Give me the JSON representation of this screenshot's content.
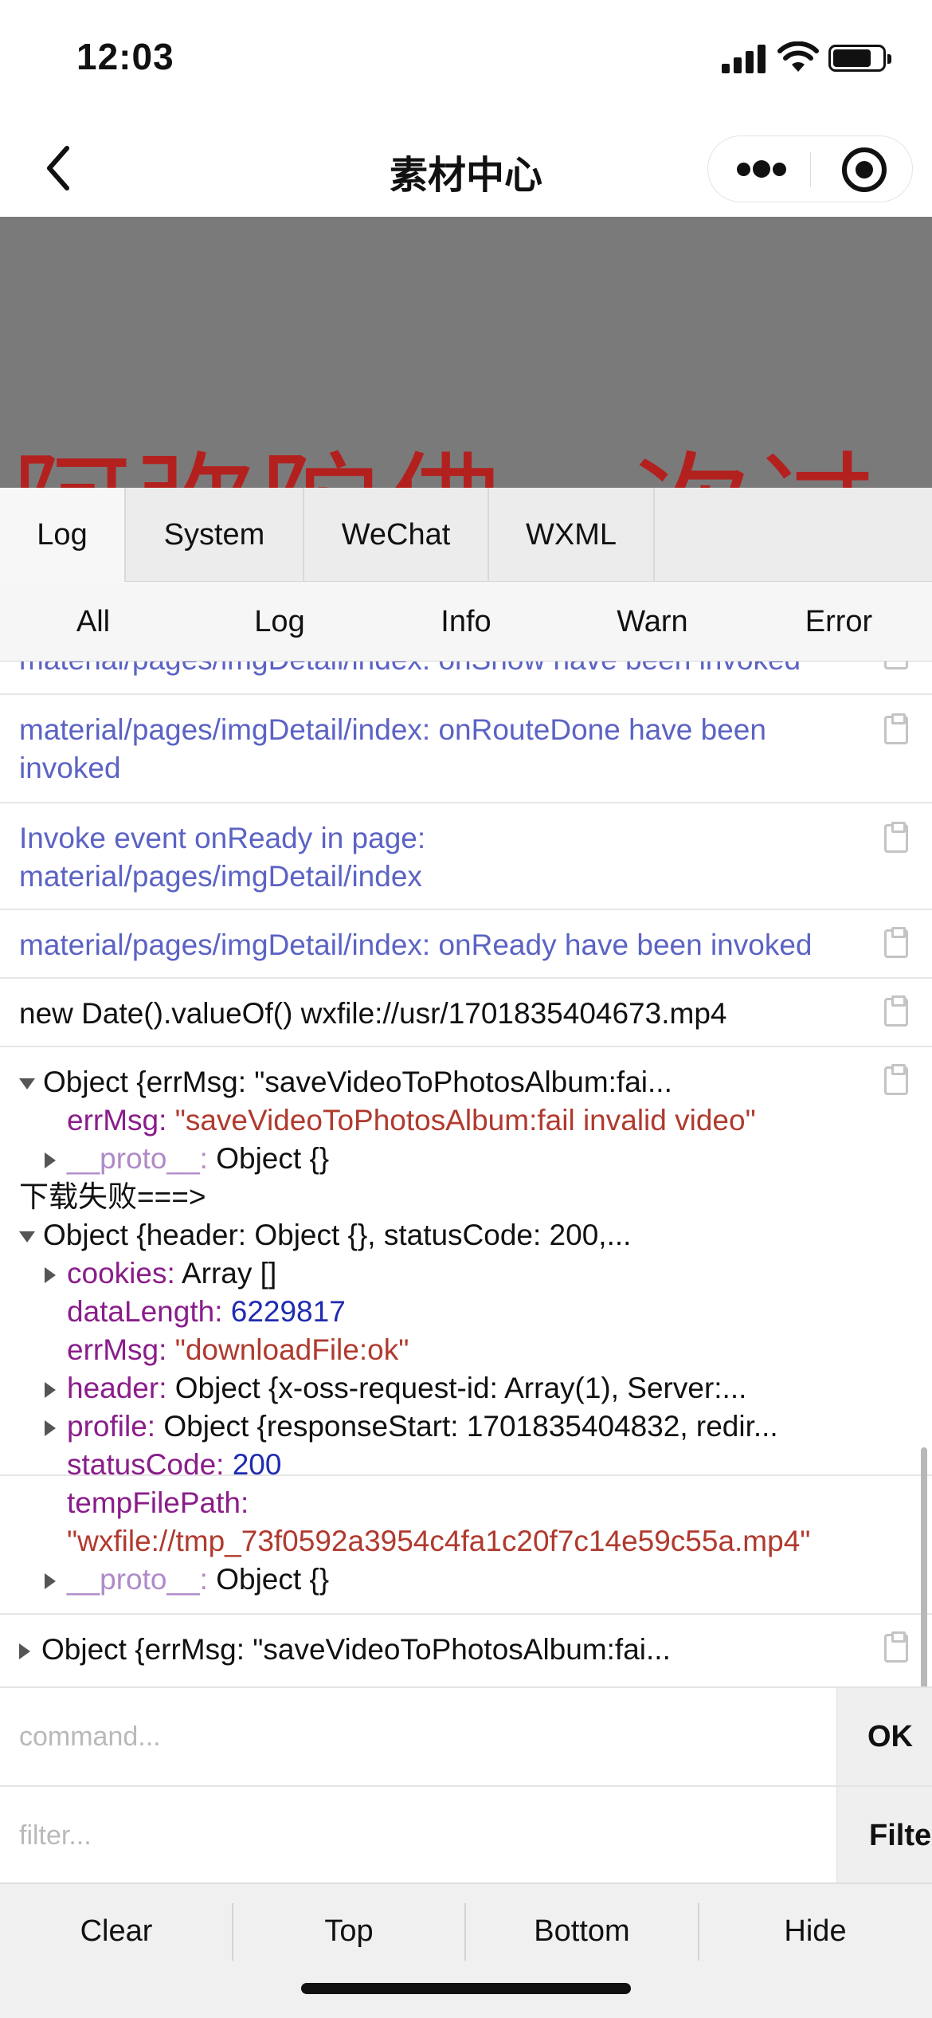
{
  "status_bar": {
    "time": "12:03"
  },
  "nav": {
    "title": "素材中心"
  },
  "page": {
    "banner_text": "阿弥陀佛一次过"
  },
  "vconsole": {
    "tabs": [
      {
        "label": "Log"
      },
      {
        "label": "System"
      },
      {
        "label": "WeChat"
      },
      {
        "label": "WXML"
      }
    ],
    "subtabs": [
      {
        "label": "All"
      },
      {
        "label": "Log"
      },
      {
        "label": "Info"
      },
      {
        "label": "Warn"
      },
      {
        "label": "Error"
      }
    ],
    "logs": {
      "row0": "material/pages/imgDetail/index: onShow have been invoked",
      "row1": "material/pages/imgDetail/index: onRouteDone have been invoked",
      "row2": "Invoke event onReady in page: material/pages/imgDetail/index",
      "row3": "material/pages/imgDetail/index: onReady have been invoked",
      "row4": "new Date().valueOf() wxfile://usr/1701835404673.mp4",
      "obj1": {
        "summary": "Object {errMsg: \"saveVideoToPhotosAlbum:fai...",
        "errMsg_key": "errMsg",
        "errMsg_val": "\"saveVideoToPhotosAlbum:fail invalid video\"",
        "proto_key": "__proto__",
        "proto_val": "Object {}"
      },
      "download_fail": "下载失败===>",
      "obj2": {
        "summary": "Object {header: Object {}, statusCode: 200,...",
        "cookies_key": "cookies",
        "cookies_val": "Array []",
        "dataLength_key": "dataLength",
        "dataLength_val": "6229817",
        "errMsg_key": "errMsg",
        "errMsg_val": "\"downloadFile:ok\"",
        "header_key": "header",
        "header_val": "Object {x-oss-request-id: Array(1), Server:...",
        "profile_key": "profile",
        "profile_val": "Object {responseStart: 1701835404832, redir...",
        "statusCode_key": "statusCode",
        "statusCode_val": "200",
        "tempFilePath_key": "tempFilePath",
        "tempFilePath_val": "\"wxfile://tmp_73f0592a3954c4fa1c20f7c14e59c55a.mp4\"",
        "proto_key": "__proto__",
        "proto_val": "Object {}"
      },
      "obj3": {
        "summary": "Object {errMsg: \"saveVideoToPhotosAlbum:fai..."
      }
    },
    "command": {
      "placeholder": "command...",
      "button": "OK"
    },
    "filter": {
      "placeholder": "filter...",
      "button": "Filter"
    },
    "toolbar": [
      {
        "label": "Clear"
      },
      {
        "label": "Top"
      },
      {
        "label": "Bottom"
      },
      {
        "label": "Hide"
      }
    ]
  }
}
